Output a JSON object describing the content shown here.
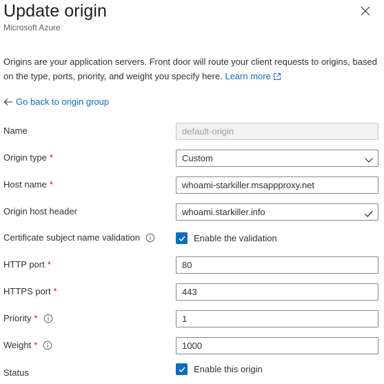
{
  "header": {
    "title": "Update origin",
    "subtitle": "Microsoft Azure"
  },
  "description": {
    "text": "Origins are your application servers. Front door will route your client requests to origins, based on the type, ports, priority, and weight you specify here.",
    "learn_more": "Learn more"
  },
  "back_link": "Go back to origin group",
  "form": {
    "name": {
      "label": "Name",
      "value": "default-origin",
      "disabled": true
    },
    "origin_type": {
      "label": "Origin type",
      "required": "*",
      "value": "Custom"
    },
    "host_name": {
      "label": "Host name",
      "required": "*",
      "value": "whoami-starkiller.msappproxy.net"
    },
    "origin_host_header": {
      "label": "Origin host header",
      "value": "whoami.starkiller.info"
    },
    "cert_validation": {
      "label": "Certificate subject name validation",
      "checkbox_label": "Enable the validation",
      "checked": true
    },
    "http_port": {
      "label": "HTTP port",
      "required": "*",
      "value": "80"
    },
    "https_port": {
      "label": "HTTPS port",
      "required": "*",
      "value": "443"
    },
    "priority": {
      "label": "Priority",
      "required": "*",
      "value": "1"
    },
    "weight": {
      "label": "Weight",
      "required": "*",
      "value": "1000"
    },
    "status": {
      "label": "Status",
      "checkbox_label": "Enable this origin",
      "checked": true
    }
  },
  "colors": {
    "accent": "#0f6cbd",
    "required": "#a4262c",
    "border": "#8a8886",
    "disabled_bg": "#f3f2f1"
  },
  "icons": [
    "close-icon",
    "external-link-icon",
    "back-arrow-icon",
    "chevron-down-icon",
    "checkmark-icon",
    "info-icon",
    "checkbox-checked-icon"
  ]
}
